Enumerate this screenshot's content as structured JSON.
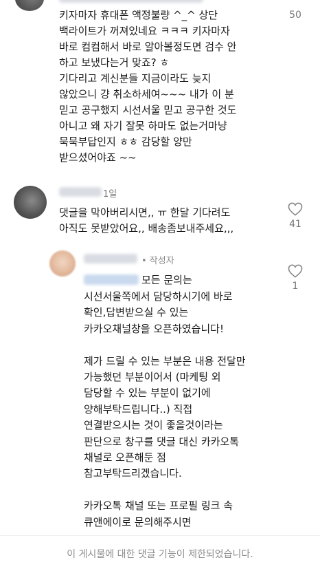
{
  "comments": [
    {
      "text": "키자마자 휴대폰 액정불량 ^_^ 상단\n백라이트가 꺼져있네요 ㅋㅋㅋ 키자마자\n바로 컴컴해서 바로 알아볼정도면 검수 안\n하고 보냈다는거 맞죠? ㅎ\n기다리고 계신분들 지금이라도 늦지\n않았으니 걍 취소하세여~~~ 내가 이 분\n믿고 공구했지 시선서울 믿고 공구한 것도\n아니고 왜 자기 잘못 하마도 없는거마냥\n묵묵부답인지 ㅎㅎ 감당할 양만\n받으셨어야죠 ~~",
      "likes": "50"
    },
    {
      "time": "1일",
      "text": "댓글을 막아버리시면,, ㅠ 한달 기다려도\n아직도 못받았어요,, 배송좀보내주세요,,,",
      "likes": "41"
    }
  ],
  "reply": {
    "author_badge": "• 작성자",
    "first_line": "모든 문의는",
    "text": "시선서울쪽에서 담당하시기에 바로\n확인,답변받으실 수 있는\n카카오채널창을 오픈하였습니다!\n\n제가 드릴 수 있는 부분은 내용 전달만\n가능했던 부분이어서 (마케팅 외\n담당할 수 있는 부분이 없기에\n양해부탁드립니다..) 직접\n연결받으시는 것이 좋을것이라는\n판단으로 창구를 댓글 대신 카카오톡\n채널로 오픈해둔 점\n참고부탁드리겠습니다.\n\n카카오톡 채널 또는 프로필 링크 속\n큐앤에이로 문의해주시면",
    "likes": "1"
  },
  "footer": {
    "notice": "이 게시물에 대한 댓글 기능이 제한되었습니다."
  }
}
